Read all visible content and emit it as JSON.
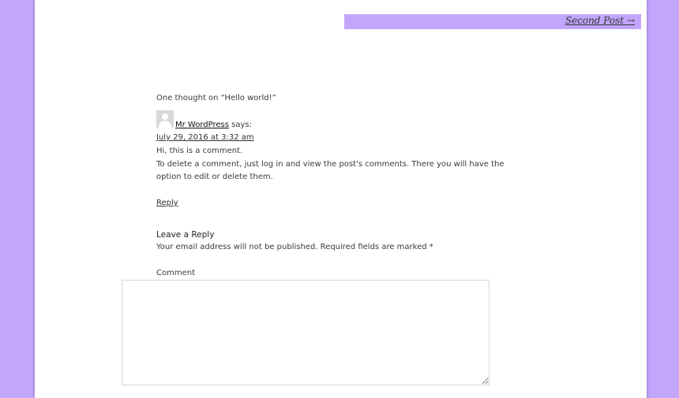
{
  "post_navigation": {
    "next_label": "Second Post",
    "next_arrow": "→"
  },
  "comments": {
    "title": "One thought on “Hello world!”",
    "items": [
      {
        "author": "Mr WordPress",
        "says": "says:",
        "date": "July 29, 2016 at 3:32 am",
        "lines": [
          "Hi, this is a comment.",
          "To delete a comment, just log in and view the post's comments. There you will have the option to edit or delete them."
        ],
        "reply_label": "Reply",
        "avatar_icon": "default-avatar-icon"
      }
    ]
  },
  "respond": {
    "title": "Leave a Reply",
    "notes": "Your email address will not be published. Required fields are marked *",
    "comment_label": "Comment",
    "comment_value": ""
  },
  "colors": {
    "background": "#c2a6fb",
    "nav_bar": "#c2a6fb",
    "page": "#ffffff"
  }
}
